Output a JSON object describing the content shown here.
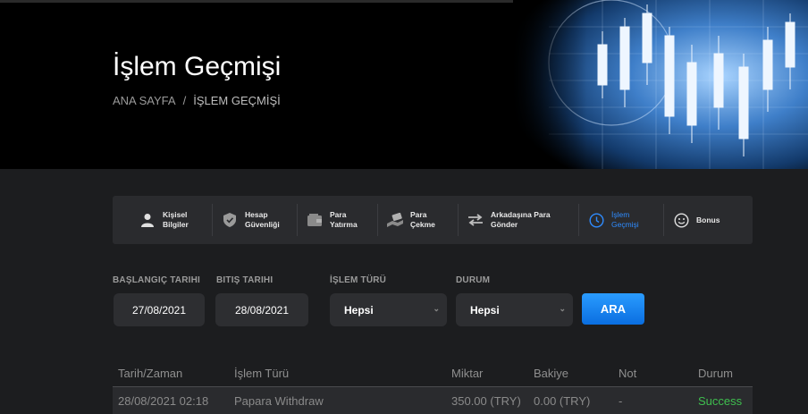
{
  "hero": {
    "title": "İşlem Geçmişi",
    "breadcrumb": {
      "home": "ANA SAYFA",
      "separator": "/",
      "current": "İŞLEM GEÇMİŞİ"
    }
  },
  "tabs": [
    {
      "line1": "Kişisel",
      "line2": "Bilgiler",
      "icon": "user-icon"
    },
    {
      "line1": "Hesap",
      "line2": "Güvenliği",
      "icon": "shield-icon"
    },
    {
      "line1": "Para",
      "line2": "Yatırma",
      "icon": "wallet-icon"
    },
    {
      "line1": "Para",
      "line2": "Çekme",
      "icon": "cash-hand-icon"
    },
    {
      "line1": "Arkadaşına Para",
      "line2": "Gönder",
      "icon": "transfer-arrows-icon"
    },
    {
      "line1": "İşlem",
      "line2": "Geçmişi",
      "icon": "history-clock-icon",
      "active": true
    },
    {
      "line1": "Bonus",
      "line2": "",
      "icon": "smiley-icon"
    }
  ],
  "filters": {
    "start_label": "BAŞLANGIÇ TARIHI",
    "start_value": "27/08/2021",
    "end_label": "BITIŞ TARIHI",
    "end_value": "28/08/2021",
    "type_label": "İŞLEM TÜRÜ",
    "type_value": "Hepsi",
    "status_label": "DURUM",
    "status_value": "Hepsi",
    "search_label": "ARA"
  },
  "table": {
    "headers": [
      "Tarih/Zaman",
      "İşlem Türü",
      "Miktar",
      "Bakiye",
      "Not",
      "Durum"
    ],
    "rows": [
      [
        "28/08/2021 02:18",
        "Papara Withdraw",
        "350.00 (TRY)",
        "0.00 (TRY)",
        "-",
        "Success"
      ]
    ]
  },
  "colors": {
    "accent": "#2f8cff",
    "success": "#3fbf4f",
    "panel": "#2a2b2e",
    "background": "#1c1d1f"
  }
}
